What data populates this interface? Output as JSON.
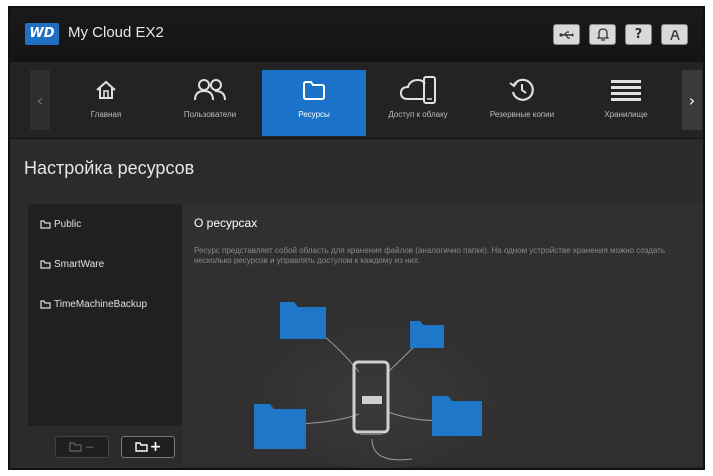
{
  "app": {
    "logo_text": "WD",
    "product_name": "My Cloud EX2",
    "brand_blue": "#1a73c8"
  },
  "toolbar_icons": [
    "usb-icon",
    "bell-icon",
    "help-icon",
    "user-icon"
  ],
  "toolbar": {
    "help_label": "?"
  },
  "nav": {
    "prev_arrow": "‹",
    "next_arrow": "›",
    "items": [
      {
        "label": "Главная",
        "icon": "home-icon"
      },
      {
        "label": "Пользователи",
        "icon": "users-icon"
      },
      {
        "label": "Ресурсы",
        "icon": "folder-icon",
        "active": true
      },
      {
        "label": "Доступ к облаку",
        "icon": "cloud-device-icon"
      },
      {
        "label": "Резервные копии",
        "icon": "history-icon"
      },
      {
        "label": "Хранилище",
        "icon": "storage-icon"
      }
    ]
  },
  "page": {
    "title": "Настройка ресурсов"
  },
  "shares": [
    {
      "name": "Public"
    },
    {
      "name": "SmartWare"
    },
    {
      "name": "TimeMachineBackup"
    }
  ],
  "share_buttons": {
    "remove": "−",
    "add": "+"
  },
  "info": {
    "heading": "О ресурсах",
    "body": "Ресурс представляет собой область для хранения файлов (аналогично папке). На одном устройстве хранения можно создать несколько ресурсов и управлять доступом к каждому из них."
  }
}
